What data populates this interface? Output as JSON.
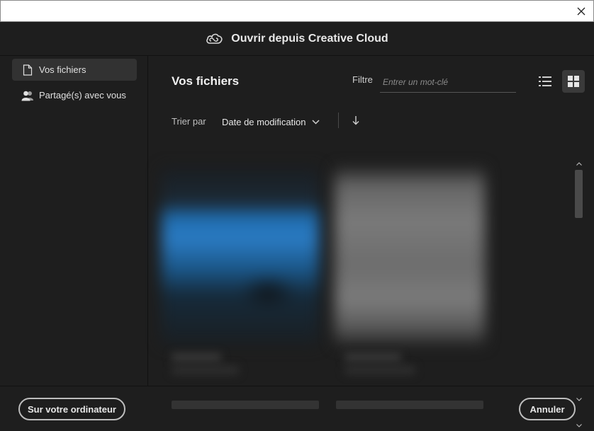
{
  "window": {
    "close_symbol": "✕"
  },
  "header": {
    "title": "Ouvrir depuis Creative Cloud",
    "logo_icon": "creative-cloud-icon"
  },
  "sidebar": {
    "items": [
      {
        "label": "Vos fichiers",
        "icon": "file-icon",
        "active": true
      },
      {
        "label": "Partagé(s) avec vous",
        "icon": "users-icon",
        "active": false
      }
    ]
  },
  "main": {
    "title": "Vos fichiers",
    "filter": {
      "label": "Filtre",
      "placeholder": "Entrer un mot-clé"
    },
    "view_modes": [
      "list-view-icon",
      "grid-view-icon"
    ],
    "active_view": "grid",
    "sort": {
      "label": "Trier par",
      "value": "Date de modification",
      "direction": "descending"
    }
  },
  "footer": {
    "local_button": "Sur votre ordinateur",
    "cancel_button": "Annuler"
  },
  "colors": {
    "background": "#1e1e1e",
    "active_item": "#323232",
    "text": "#e6e6e6",
    "button_border": "#bdbdbd"
  }
}
